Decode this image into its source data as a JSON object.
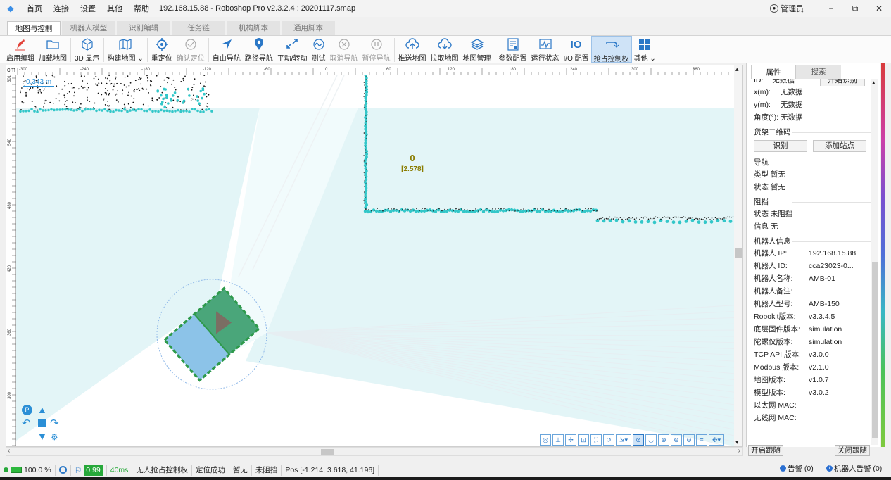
{
  "app": {
    "menu": [
      "首页",
      "连接",
      "设置",
      "其他",
      "帮助"
    ],
    "title": "192.168.15.88 - Roboshop Pro v2.3.2.4 : 20201117.smap",
    "user": "管理员",
    "window_buttons": [
      "−",
      "⧉",
      "✕"
    ]
  },
  "tabs": [
    "地图与控制",
    "机器人模型",
    "识别编辑",
    "任务链",
    "机构脚本",
    "通用脚本"
  ],
  "toolbar": [
    {
      "label": "启用编辑",
      "icon": "pen-icon"
    },
    {
      "label": "加载地图",
      "icon": "folder-icon"
    },
    {
      "label": "3D 显示",
      "icon": "cube-icon"
    },
    {
      "label": "构建地图",
      "icon": "map-icon",
      "dropdown": "⌄"
    },
    {
      "label": "重定位",
      "icon": "crosshair-icon"
    },
    {
      "label": "确认定位",
      "icon": "check-circle-icon",
      "disabled": true
    },
    {
      "label": "自由导航",
      "icon": "navigate-arrow-icon"
    },
    {
      "label": "路径导航",
      "icon": "location-pin-icon"
    },
    {
      "label": "平动/转动",
      "icon": "move-rotate-icon"
    },
    {
      "label": "测试",
      "icon": "wave-icon"
    },
    {
      "label": "取消导航",
      "icon": "cancel-circle-icon",
      "disabled": true
    },
    {
      "label": "暂停导航",
      "icon": "pause-circle-icon",
      "disabled": true
    },
    {
      "label": "推送地图",
      "icon": "cloud-upload-icon"
    },
    {
      "label": "拉取地图",
      "icon": "cloud-download-icon"
    },
    {
      "label": "地图管理",
      "icon": "layers-icon"
    },
    {
      "label": "参数配置",
      "icon": "params-icon"
    },
    {
      "label": "运行状态",
      "icon": "monitor-wave-icon"
    },
    {
      "label": "I/O 配置",
      "icon": "io-icon",
      "glyph": "IO"
    },
    {
      "label": "抢占控制权",
      "icon": "grab-control-icon",
      "active": true
    },
    {
      "label": "其他",
      "icon": "grid-icon",
      "dropdown": "⌄"
    }
  ],
  "map": {
    "unit": "cm",
    "ruler_top": [
      "-300",
      "-240",
      "-180",
      "-120",
      "-60",
      "0",
      "60",
      "120",
      "180",
      "240",
      "300",
      "360"
    ],
    "ruler_left": [
      "601",
      "540",
      "480",
      "420",
      "360",
      "300"
    ],
    "scale_text": "0.343 m",
    "station_id": "0",
    "station_value": "[2.578]",
    "colors": {
      "laser": "#33c7c9",
      "robot_body": "#8cc3e8",
      "robot_front": "#4aa67a",
      "robot_border": "#2e9a4b",
      "fov": "#e3f5f7"
    }
  },
  "view_tools": [
    "measure-icon",
    "ruler-icon",
    "fit-icon",
    "zoom-region-icon",
    "frame-icon",
    "rotate-icon",
    "export-icon",
    "no-target-icon",
    "eye-icon",
    "zoom-in-icon",
    "zoom-out-icon",
    "zoom-fit-icon",
    "list-icon",
    "pan-icon"
  ],
  "panel": {
    "tabs": [
      "属性",
      "搜索"
    ],
    "top_partial_label": "ID:",
    "top_partial_value": "无数据",
    "top_partial_button": "开始识别",
    "coords": [
      {
        "k": "x(m):",
        "v": "无数据"
      },
      {
        "k": "y(m):",
        "v": "无数据"
      },
      {
        "k": "角度(°):",
        "v": "无数据"
      }
    ],
    "shelf": {
      "title": "货架二维码",
      "btn1": "识别",
      "btn2": "添加站点"
    },
    "nav": {
      "title": "导航",
      "rows": [
        {
          "k": "类型",
          "v": "暂无"
        },
        {
          "k": "状态",
          "v": "暂无"
        }
      ]
    },
    "block": {
      "title": "阻挡",
      "rows": [
        {
          "k": "状态",
          "v": "未阻挡"
        },
        {
          "k": "信息",
          "v": "无"
        }
      ]
    },
    "robot": {
      "title": "机器人信息",
      "rows": [
        {
          "k": "机器人 IP:",
          "v": "192.168.15.88"
        },
        {
          "k": "机器人 ID:",
          "v": "cca23023-0..."
        },
        {
          "k": "机器人名称:",
          "v": "AMB-01"
        },
        {
          "k": "机器人备注:",
          "v": ""
        },
        {
          "k": "机器人型号:",
          "v": "AMB-150"
        },
        {
          "k": "Robokit版本:",
          "v": "v3.3.4.5"
        },
        {
          "k": "底层固件版本:",
          "v": "simulation"
        },
        {
          "k": "陀螺仪版本:",
          "v": "simulation"
        },
        {
          "k": "TCP API 版本:",
          "v": "v3.0.0"
        },
        {
          "k": "Modbus 版本:",
          "v": "v2.1.0"
        },
        {
          "k": "地图版本:",
          "v": "v1.0.7"
        },
        {
          "k": "模型版本:",
          "v": "v3.0.2"
        },
        {
          "k": "以太网 MAC:",
          "v": ""
        },
        {
          "k": "无线网 MAC:",
          "v": ""
        }
      ]
    },
    "follow_on": "开启跟随",
    "follow_off": "关闭跟随"
  },
  "status": {
    "battery": "100.0 %",
    "confidence": "0.99",
    "latency": "40ms",
    "control": "无人抢占控制权",
    "localization": "定位成功",
    "state": "暂无",
    "blocked": "未阻挡",
    "pos": "Pos [-1.214, 3.618, 41.196]",
    "alarm": "告警 (0)",
    "robot_alarm": "机器人告警 (0)"
  }
}
